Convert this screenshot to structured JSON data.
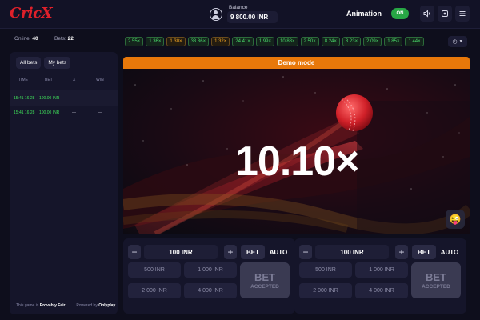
{
  "header": {
    "logo": "CricX",
    "balance_label": "Balance",
    "balance_value": "9 800.00 INR",
    "animation_label": "Animation",
    "animation_toggle": "ON"
  },
  "stats": {
    "online_label": "Online:",
    "online_value": "40",
    "bets_label": "Bets:",
    "bets_value": "22"
  },
  "bets_panel": {
    "tabs": [
      "All bets",
      "My bets"
    ],
    "columns": [
      "TIME",
      "BET",
      "X",
      "WIN"
    ],
    "rows": [
      {
        "time": "15:41 16:28",
        "bet": "100.00 INR",
        "x": "—",
        "win": "—"
      },
      {
        "time": "15:41 16:28",
        "bet": "100.00 INR",
        "x": "—",
        "win": "—"
      }
    ],
    "footer_left_label": "This game is",
    "footer_left_value": "Provably Fair",
    "footer_right_label": "Powered by",
    "footer_right_value": "Onlyplay"
  },
  "multipliers": [
    {
      "value": "2.55×",
      "color": "green"
    },
    {
      "value": "1.36×",
      "color": "green"
    },
    {
      "value": "1.30×",
      "color": "orange"
    },
    {
      "value": "33.36×",
      "color": "green"
    },
    {
      "value": "1.32×",
      "color": "orange"
    },
    {
      "value": "24.41×",
      "color": "green"
    },
    {
      "value": "1.99×",
      "color": "green"
    },
    {
      "value": "10.88×",
      "color": "green"
    },
    {
      "value": "2.50×",
      "color": "green"
    },
    {
      "value": "8.24×",
      "color": "green"
    },
    {
      "value": "3.23×",
      "color": "green"
    },
    {
      "value": "2.09×",
      "color": "green"
    },
    {
      "value": "1.85×",
      "color": "green"
    },
    {
      "value": "1.44×",
      "color": "green"
    }
  ],
  "game": {
    "demo_label": "Demo mode",
    "current_multiplier": "10.10×",
    "emoji": "😜"
  },
  "bet_panels": [
    {
      "amount": "100 INR",
      "mode_bet": "BET",
      "mode_auto": "AUTO",
      "presets": [
        "500 INR",
        "1 000 INR",
        "2 000 INR",
        "4 000 INR"
      ],
      "button_main": "BET",
      "button_sub": "ACCEPTED"
    },
    {
      "amount": "100 INR",
      "mode_bet": "BET",
      "mode_auto": "AUTO",
      "presets": [
        "500 INR",
        "1 000 INR",
        "2 000 INR",
        "4 000 INR"
      ],
      "button_main": "BET",
      "button_sub": "ACCEPTED"
    }
  ],
  "colors": {
    "accent_red": "#e0202a",
    "demo_orange": "#e8780a",
    "toggle_green": "#28a745",
    "win_green": "#3fe05a"
  }
}
